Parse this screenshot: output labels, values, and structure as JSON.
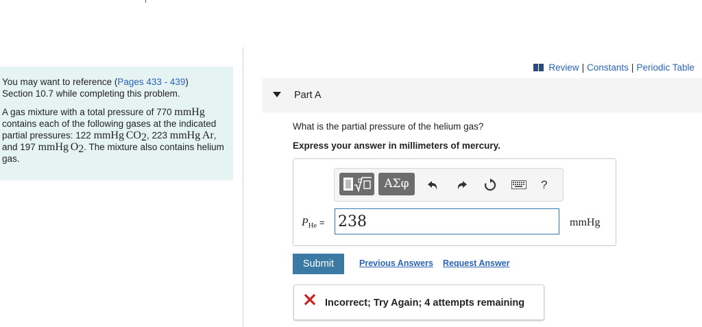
{
  "reference": {
    "intro": "You may want to reference (",
    "pages_link": "Pages 433 - 439",
    "intro_end": ")",
    "section_text": "Section 10.7 while completing this problem."
  },
  "problem": {
    "t1": "A gas mixture with a total pressure of 770 ",
    "unit_mmHg": "mmHg",
    "t2": " contains each of the following gases at the indicated partial pressures: 122 ",
    "co2_formula": "CO",
    "co2_sub": "2",
    "t3": ", 223 ",
    "ar_formula": "Ar",
    "t4": ", and 197 ",
    "o2_formula": "O",
    "o2_sub": "2",
    "t5": ". The mixture also contains helium gas."
  },
  "toplinks": {
    "review": "Review",
    "sep": "|",
    "constants": "Constants",
    "periodic": "Periodic Table"
  },
  "part": {
    "title": "Part A"
  },
  "question": "What is the partial pressure of the helium gas?",
  "instruction": "Express your answer in millimeters of mercury.",
  "toolbar": {
    "greek_label": "ΑΣφ",
    "help_label": "?",
    "icons": [
      "templates-icon",
      "greek-symbols-icon",
      "undo-icon",
      "redo-icon",
      "reset-icon",
      "keyboard-icon",
      "help-icon"
    ]
  },
  "answer": {
    "var": "P",
    "var_sub": "He",
    "equals": "=",
    "value": "238",
    "unit": "mmHg"
  },
  "actions": {
    "submit": "Submit",
    "previous": "Previous Answers",
    "request": "Request Answer"
  },
  "feedback": {
    "message": "Incorrect; Try Again; 4 attempts remaining",
    "status_color": "#cc2222"
  },
  "colors": {
    "link": "#2a64b5",
    "submit": "#3c7aa6",
    "panel_bg": "#e6f3f3"
  }
}
